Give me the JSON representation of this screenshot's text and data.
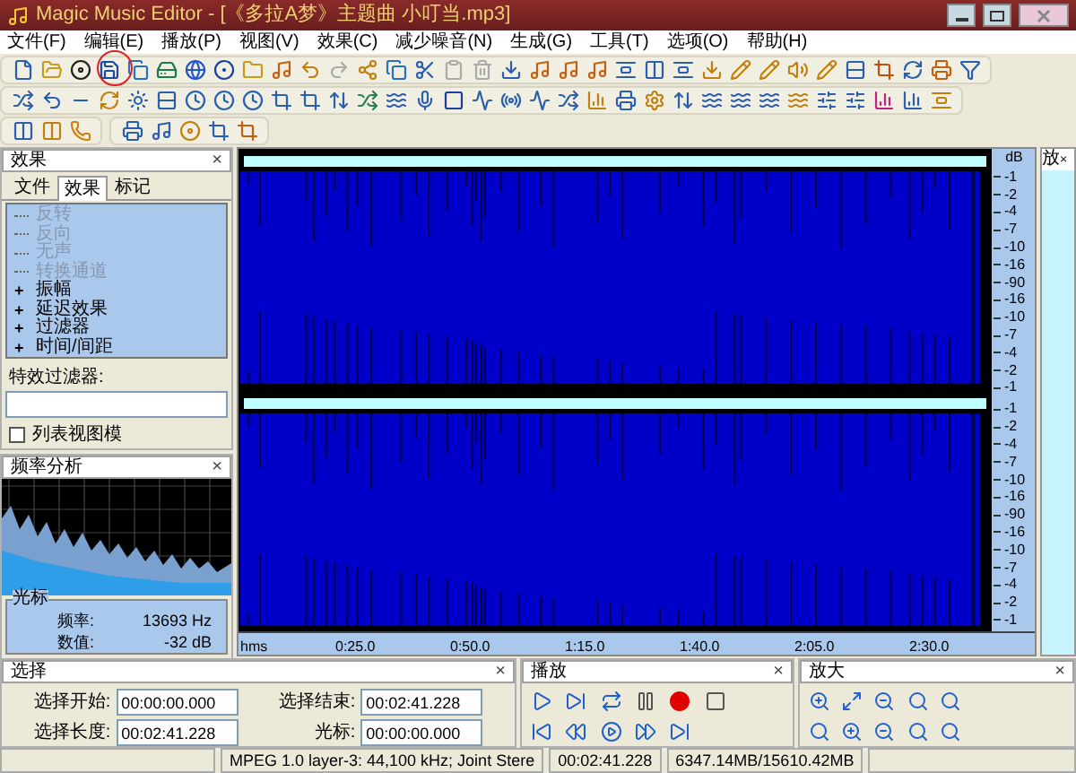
{
  "window": {
    "title": "Magic Music Editor - [《多拉A梦》主题曲 小叮当.mp3]"
  },
  "menu": [
    "文件(F)",
    "编辑(E)",
    "播放(P)",
    "视图(V)",
    "效果(C)",
    "减少噪音(N)",
    "生成(G)",
    "工具(T)",
    "选项(O)",
    "帮助(H)"
  ],
  "effects_panel": {
    "title": "效果",
    "close": "×",
    "tabs": [
      {
        "label": "文件",
        "selected": false
      },
      {
        "label": "效果",
        "selected": true
      },
      {
        "label": "标记",
        "selected": false
      }
    ],
    "tree": [
      {
        "label": "反转",
        "kind": "leaf",
        "disabled": true
      },
      {
        "label": "反向",
        "kind": "leaf",
        "disabled": true
      },
      {
        "label": "无声",
        "kind": "leaf",
        "disabled": true
      },
      {
        "label": "转换通道",
        "kind": "leaf",
        "disabled": true
      },
      {
        "label": "振幅",
        "kind": "group",
        "toggle": "+",
        "disabled": false
      },
      {
        "label": "延迟效果",
        "kind": "group",
        "toggle": "+",
        "disabled": false
      },
      {
        "label": "过滤器",
        "kind": "group",
        "toggle": "+",
        "disabled": false
      },
      {
        "label": "时间/间距",
        "kind": "group",
        "toggle": "+",
        "disabled": false
      }
    ],
    "filter_label": "特效过滤器:",
    "list_view": {
      "label": "列表视图模",
      "checked": false
    }
  },
  "frequency_panel": {
    "title": "频率分析",
    "close": "×",
    "cursor_title": "光标",
    "readings": [
      {
        "label": "频率:",
        "value": "13693 Hz"
      },
      {
        "label": "数值:",
        "value": "-32 dB"
      }
    ]
  },
  "waveform": {
    "db_unit": "dB",
    "channels": [
      {
        "scale": [
          "-1",
          "-2",
          "-4",
          "-7",
          "-10",
          "-16",
          "-90",
          "-16",
          "-10",
          "-7",
          "-4",
          "-2",
          "-1"
        ]
      },
      {
        "scale": [
          "-1",
          "-2",
          "-4",
          "-7",
          "-10",
          "-16",
          "-90",
          "-16",
          "-10",
          "-7",
          "-4",
          "-2",
          "-1"
        ]
      }
    ],
    "time_ruler": [
      "hms",
      "0:25.0",
      "0:50.0",
      "1:15.0",
      "1:40.0",
      "2:05.0",
      "2:30.0"
    ]
  },
  "side_strip": {
    "label": "放",
    "close": "×"
  },
  "selection_panel": {
    "title": "选择",
    "close": "×",
    "fields": [
      {
        "label": "选择开始:",
        "value": "00:00:00.000"
      },
      {
        "label": "选择结束:",
        "value": "00:02:41.228"
      },
      {
        "label": "选择长度:",
        "value": "00:02:41.228"
      },
      {
        "label": "光标:",
        "value": "00:00:00.000"
      }
    ]
  },
  "playback_panel": {
    "title": "播放",
    "close": "×"
  },
  "zoom_panel": {
    "title": "放大",
    "close": "×"
  },
  "status_bar": [
    "MPEG 1.0 layer-3: 44,100 kHz; Joint Stere",
    "00:02:41.228",
    "6347.14MB/15610.42MB"
  ]
}
